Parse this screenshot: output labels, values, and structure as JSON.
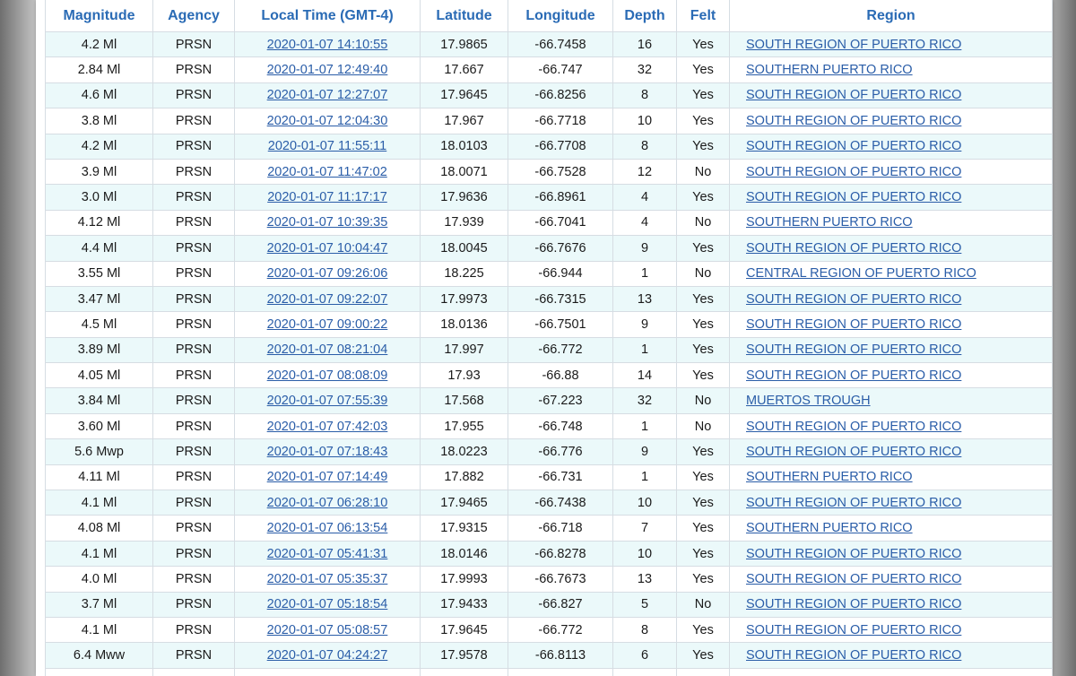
{
  "table": {
    "headers": {
      "magnitude": "Magnitude",
      "agency": "Agency",
      "local_time": "Local Time (GMT-4)",
      "latitude": "Latitude",
      "longitude": "Longitude",
      "depth": "Depth",
      "felt": "Felt",
      "region": "Region"
    },
    "rows": [
      {
        "magnitude": "4.2 Ml",
        "agency": "PRSN",
        "time": "2020-01-07 14:10:55",
        "latitude": "17.9865",
        "longitude": "-66.7458",
        "depth": "16",
        "felt": "Yes",
        "region": "SOUTH REGION OF PUERTO RICO"
      },
      {
        "magnitude": "2.84 Ml",
        "agency": "PRSN",
        "time": "2020-01-07 12:49:40",
        "latitude": "17.667",
        "longitude": "-66.747",
        "depth": "32",
        "felt": "Yes",
        "region": "SOUTHERN PUERTO RICO"
      },
      {
        "magnitude": "4.6 Ml",
        "agency": "PRSN",
        "time": "2020-01-07 12:27:07",
        "latitude": "17.9645",
        "longitude": "-66.8256",
        "depth": "8",
        "felt": "Yes",
        "region": "SOUTH REGION OF PUERTO RICO"
      },
      {
        "magnitude": "3.8 Ml",
        "agency": "PRSN",
        "time": "2020-01-07 12:04:30",
        "latitude": "17.967",
        "longitude": "-66.7718",
        "depth": "10",
        "felt": "Yes",
        "region": "SOUTH REGION OF PUERTO RICO"
      },
      {
        "magnitude": "4.2 Ml",
        "agency": "PRSN",
        "time": "2020-01-07 11:55:11",
        "latitude": "18.0103",
        "longitude": "-66.7708",
        "depth": "8",
        "felt": "Yes",
        "region": "SOUTH REGION OF PUERTO RICO"
      },
      {
        "magnitude": "3.9 Ml",
        "agency": "PRSN",
        "time": "2020-01-07 11:47:02",
        "latitude": "18.0071",
        "longitude": "-66.7528",
        "depth": "12",
        "felt": "No",
        "region": "SOUTH REGION OF PUERTO RICO"
      },
      {
        "magnitude": "3.0 Ml",
        "agency": "PRSN",
        "time": "2020-01-07 11:17:17",
        "latitude": "17.9636",
        "longitude": "-66.8961",
        "depth": "4",
        "felt": "Yes",
        "region": "SOUTH REGION OF PUERTO RICO"
      },
      {
        "magnitude": "4.12 Ml",
        "agency": "PRSN",
        "time": "2020-01-07 10:39:35",
        "latitude": "17.939",
        "longitude": "-66.7041",
        "depth": "4",
        "felt": "No",
        "region": "SOUTHERN PUERTO RICO"
      },
      {
        "magnitude": "4.4 Ml",
        "agency": "PRSN",
        "time": "2020-01-07 10:04:47",
        "latitude": "18.0045",
        "longitude": "-66.7676",
        "depth": "9",
        "felt": "Yes",
        "region": "SOUTH REGION OF PUERTO RICO"
      },
      {
        "magnitude": "3.55 Ml",
        "agency": "PRSN",
        "time": "2020-01-07 09:26:06",
        "latitude": "18.225",
        "longitude": "-66.944",
        "depth": "1",
        "felt": "No",
        "region": "CENTRAL REGION OF PUERTO RICO"
      },
      {
        "magnitude": "3.47 Ml",
        "agency": "PRSN",
        "time": "2020-01-07 09:22:07",
        "latitude": "17.9973",
        "longitude": "-66.7315",
        "depth": "13",
        "felt": "Yes",
        "region": "SOUTH REGION OF PUERTO RICO"
      },
      {
        "magnitude": "4.5 Ml",
        "agency": "PRSN",
        "time": "2020-01-07 09:00:22",
        "latitude": "18.0136",
        "longitude": "-66.7501",
        "depth": "9",
        "felt": "Yes",
        "region": "SOUTH REGION OF PUERTO RICO"
      },
      {
        "magnitude": "3.89 Ml",
        "agency": "PRSN",
        "time": "2020-01-07 08:21:04",
        "latitude": "17.997",
        "longitude": "-66.772",
        "depth": "1",
        "felt": "Yes",
        "region": "SOUTH REGION OF PUERTO RICO"
      },
      {
        "magnitude": "4.05 Ml",
        "agency": "PRSN",
        "time": "2020-01-07 08:08:09",
        "latitude": "17.93",
        "longitude": "-66.88",
        "depth": "14",
        "felt": "Yes",
        "region": "SOUTH REGION OF PUERTO RICO"
      },
      {
        "magnitude": "3.84 Ml",
        "agency": "PRSN",
        "time": "2020-01-07 07:55:39",
        "latitude": "17.568",
        "longitude": "-67.223",
        "depth": "32",
        "felt": "No",
        "region": "MUERTOS TROUGH"
      },
      {
        "magnitude": "3.60 Ml",
        "agency": "PRSN",
        "time": "2020-01-07 07:42:03",
        "latitude": "17.955",
        "longitude": "-66.748",
        "depth": "1",
        "felt": "No",
        "region": "SOUTH REGION OF PUERTO RICO"
      },
      {
        "magnitude": "5.6 Mwp",
        "agency": "PRSN",
        "time": "2020-01-07 07:18:43",
        "latitude": "18.0223",
        "longitude": "-66.776",
        "depth": "9",
        "felt": "Yes",
        "region": "SOUTH REGION OF PUERTO RICO"
      },
      {
        "magnitude": "4.11 Ml",
        "agency": "PRSN",
        "time": "2020-01-07 07:14:49",
        "latitude": "17.882",
        "longitude": "-66.731",
        "depth": "1",
        "felt": "Yes",
        "region": "SOUTHERN PUERTO RICO"
      },
      {
        "magnitude": "4.1 Ml",
        "agency": "PRSN",
        "time": "2020-01-07 06:28:10",
        "latitude": "17.9465",
        "longitude": "-66.7438",
        "depth": "10",
        "felt": "Yes",
        "region": "SOUTH REGION OF PUERTO RICO"
      },
      {
        "magnitude": "4.08 Ml",
        "agency": "PRSN",
        "time": "2020-01-07 06:13:54",
        "latitude": "17.9315",
        "longitude": "-66.718",
        "depth": "7",
        "felt": "Yes",
        "region": "SOUTHERN PUERTO RICO"
      },
      {
        "magnitude": "4.1 Ml",
        "agency": "PRSN",
        "time": "2020-01-07 05:41:31",
        "latitude": "18.0146",
        "longitude": "-66.8278",
        "depth": "10",
        "felt": "Yes",
        "region": "SOUTH REGION OF PUERTO RICO"
      },
      {
        "magnitude": "4.0 Ml",
        "agency": "PRSN",
        "time": "2020-01-07 05:35:37",
        "latitude": "17.9993",
        "longitude": "-66.7673",
        "depth": "13",
        "felt": "Yes",
        "region": "SOUTH REGION OF PUERTO RICO"
      },
      {
        "magnitude": "3.7 Ml",
        "agency": "PRSN",
        "time": "2020-01-07 05:18:54",
        "latitude": "17.9433",
        "longitude": "-66.827",
        "depth": "5",
        "felt": "No",
        "region": "SOUTH REGION OF PUERTO RICO"
      },
      {
        "magnitude": "4.1 Ml",
        "agency": "PRSN",
        "time": "2020-01-07 05:08:57",
        "latitude": "17.9645",
        "longitude": "-66.772",
        "depth": "8",
        "felt": "Yes",
        "region": "SOUTH REGION OF PUERTO RICO"
      },
      {
        "magnitude": "6.4 Mww",
        "agency": "PRSN",
        "time": "2020-01-07 04:24:27",
        "latitude": "17.9578",
        "longitude": "-66.8113",
        "depth": "6",
        "felt": "Yes",
        "region": "SOUTH REGION OF PUERTO RICO"
      }
    ]
  },
  "colors": {
    "header_text": "#2a6bb5",
    "link": "#2a5da8",
    "row_alt_bg": "#ebf9fa",
    "border": "#d6dde3"
  }
}
